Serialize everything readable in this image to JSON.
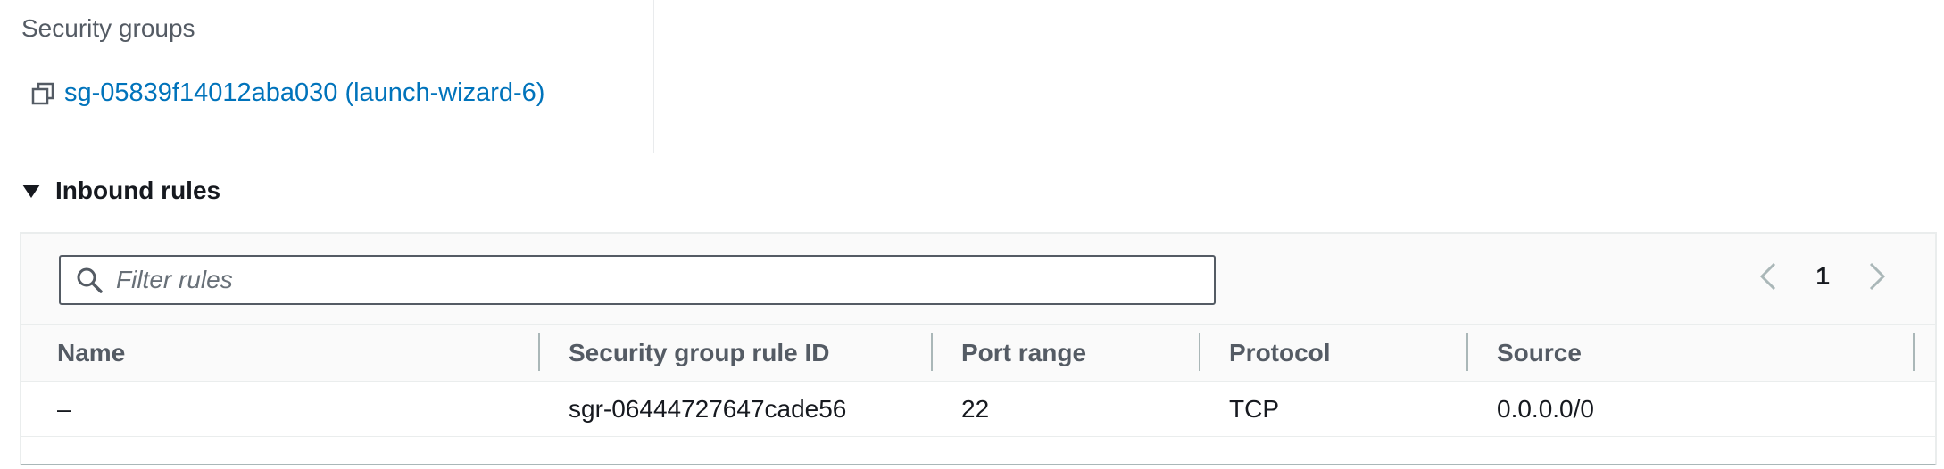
{
  "security_groups": {
    "label": "Security groups",
    "link_text": "sg-05839f14012aba030 (launch-wizard-6)",
    "copy_icon": "copy-icon"
  },
  "inbound_rules": {
    "title": "Inbound rules",
    "expanded": true,
    "filter": {
      "placeholder": "Filter rules",
      "value": ""
    },
    "pagination": {
      "current_page": "1",
      "prev_icon": "chevron-left-icon",
      "next_icon": "chevron-right-icon"
    },
    "columns": [
      "Name",
      "Security group rule ID",
      "Port range",
      "Protocol",
      "Source"
    ],
    "rows": [
      {
        "name": "–",
        "rule_id": "sgr-06444727647cade56",
        "port_range": "22",
        "protocol": "TCP",
        "source": "0.0.0.0/0"
      }
    ]
  },
  "colors": {
    "link": "#0073bb",
    "text": "#16191f",
    "muted": "#545b64",
    "border": "#eaeded"
  }
}
